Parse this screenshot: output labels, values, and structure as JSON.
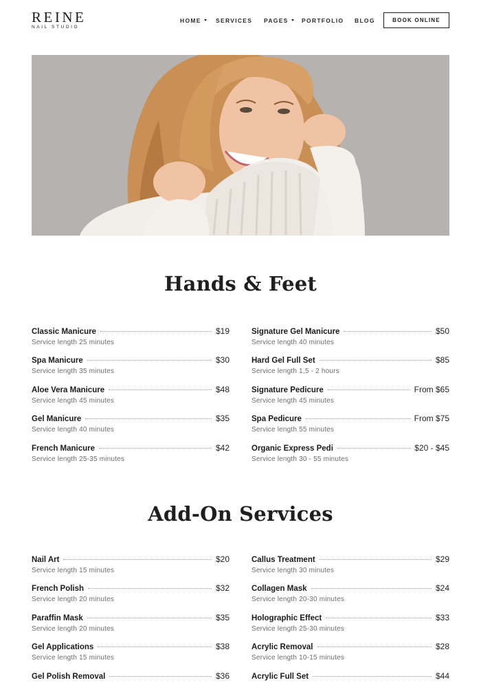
{
  "brand": {
    "name": "REINE",
    "tagline": "NAIL STUDIO"
  },
  "nav": {
    "items": [
      {
        "label": "HOME",
        "has_dropdown": true
      },
      {
        "label": "SERVICES",
        "has_dropdown": false
      },
      {
        "label": "PAGES",
        "has_dropdown": true
      },
      {
        "label": "PORTFOLIO",
        "has_dropdown": false
      },
      {
        "label": "BLOG",
        "has_dropdown": false
      }
    ],
    "cta": "BOOK ONLINE"
  },
  "sections": [
    {
      "title": "Hands & Feet",
      "left": [
        {
          "name": "Classic Manicure",
          "price": "$19",
          "length": "Service length 25 minutes"
        },
        {
          "name": "Spa Manicure",
          "price": "$30",
          "length": "Service length 35 minutes"
        },
        {
          "name": "Aloe Vera Manicure",
          "price": "$48",
          "length": "Service length 45 minutes"
        },
        {
          "name": "Gel Manicure",
          "price": "$35",
          "length": "Service length 40 minutes"
        },
        {
          "name": "French Manicure",
          "price": "$42",
          "length": "Service length 25-35 minutes"
        }
      ],
      "right": [
        {
          "name": "Signature Gel Manicure",
          "price": "$50",
          "length": "Service length 40 minutes"
        },
        {
          "name": "Hard Gel Full Set",
          "price": "$85",
          "length": "Service length 1,5 - 2 hours"
        },
        {
          "name": "Signature Pedicure",
          "price": "From $65",
          "length": "Service length 45 minutes"
        },
        {
          "name": "Spa Pedicure",
          "price": "From $75",
          "length": "Service length 55 minutes"
        },
        {
          "name": "Organic Express Pedi",
          "price": "$20 - $45",
          "length": "Service length 30 - 55 minutes"
        }
      ]
    },
    {
      "title": "Add-On Services",
      "left": [
        {
          "name": "Nail Art",
          "price": "$20",
          "length": "Service length 15 minutes"
        },
        {
          "name": "French Polish",
          "price": "$32",
          "length": "Service length 20 minutes"
        },
        {
          "name": "Paraffin Mask",
          "price": "$35",
          "length": "Service length 20 minutes"
        },
        {
          "name": "Gel Applications",
          "price": "$38",
          "length": "Service length 15 minutes"
        },
        {
          "name": "Gel Polish Removal",
          "price": "$36",
          "length": ""
        }
      ],
      "right": [
        {
          "name": "Callus Treatment",
          "price": "$29",
          "length": "Service length 30 minutes"
        },
        {
          "name": "Collagen Mask",
          "price": "$24",
          "length": "Service length 20-30 minutes"
        },
        {
          "name": "Holographic Effect",
          "price": "$33",
          "length": "Service length 25-30 minutes"
        },
        {
          "name": "Acrylic Removal",
          "price": "$28",
          "length": "Service length 10-15 minutes"
        },
        {
          "name": "Acrylic Full Set",
          "price": "$44",
          "length": ""
        }
      ]
    }
  ],
  "colors": {
    "hero_background": "#b6b2af",
    "text": "#1b1b1b",
    "muted": "#6c6c6c"
  }
}
